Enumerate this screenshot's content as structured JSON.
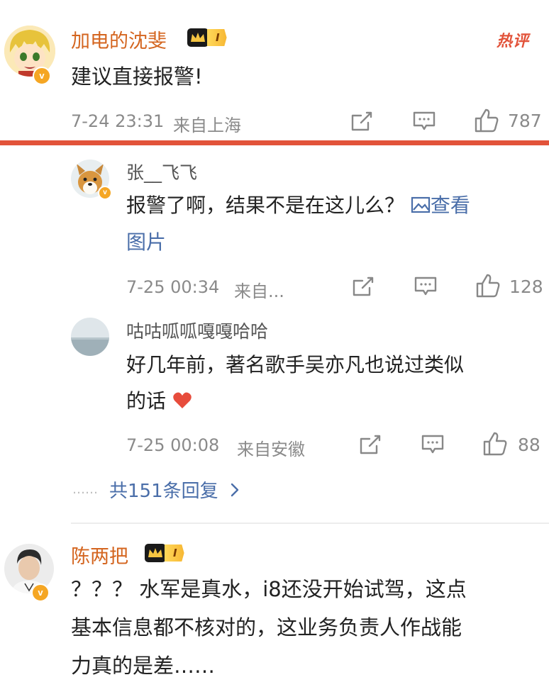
{
  "comments": [
    {
      "username": "加电的沈斐",
      "level": "I",
      "badge": "热评",
      "content": "建议直接报警!",
      "time": "7-24 23:31",
      "location": "来自上海",
      "likes": "787"
    },
    {
      "username": "陈两把",
      "level": "I",
      "content_lines": [
        "？？？ 水军是真水，i8还没开始试驾，这点",
        "基本信息都不核对的，这业务负责人作战能",
        "力真的是差……"
      ]
    }
  ],
  "replies": [
    {
      "username": "张__飞飞",
      "content_line1": "报警了啊，结果不是在这儿么？",
      "link_part1": "查看",
      "link_part2": "图片",
      "time": "7-25 00:34",
      "location": "来自...",
      "likes": "128"
    },
    {
      "username": "咕咕呱呱嘎嘎哈哈",
      "content_line1": "好几年前，著名歌手吴亦凡也说过类似",
      "content_line2": "的话",
      "time": "7-25 00:08",
      "location": "来自安徽",
      "likes": "88"
    }
  ],
  "more_replies": {
    "dots": "……",
    "label": "共151条回复"
  },
  "colors": {
    "accent": "#e2533a",
    "username": "#d4651f",
    "link": "#4a6ea9",
    "meta": "#8a8a8a"
  },
  "icons": [
    "share-icon",
    "comment-icon",
    "like-icon",
    "image-icon",
    "heart-icon",
    "chevron-right-icon",
    "verified-v-icon",
    "crown-icon"
  ]
}
